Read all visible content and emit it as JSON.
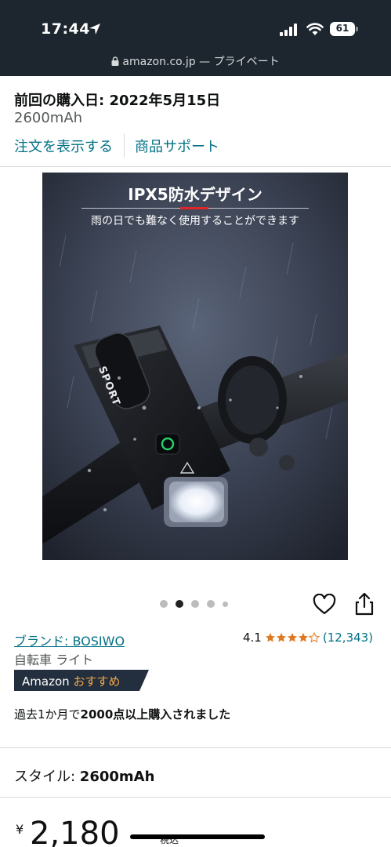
{
  "status_bar": {
    "time": "17:44",
    "battery": "61"
  },
  "url_bar": {
    "domain": "amazon.co.jp",
    "suffix": " — プライベート"
  },
  "order": {
    "last_purchase": "前回の購入日: 2022年5月15日",
    "variant": "2600mAh",
    "view_order": "注文を表示する",
    "product_support": "商品サポート"
  },
  "image": {
    "heading": "IPX5防水デザイン",
    "subheading": "雨の日でも難なく使用することができます",
    "device_label": "SPORT"
  },
  "carousel": {
    "count": 5,
    "active_index": 1
  },
  "brand": {
    "link": "ブランド: BOSIWO",
    "category": "自転車 ライト"
  },
  "rating": {
    "value": "4.1",
    "stars": 4.1,
    "count": "(12,343)"
  },
  "badge": {
    "prefix": "Amazon ",
    "highlight": "おすすめ"
  },
  "bought": {
    "pre": "過去1か月で",
    "bold": "2000点以上購入されました"
  },
  "style": {
    "label": "スタイル: ",
    "value": "2600mAh"
  },
  "price": {
    "currency": "¥",
    "amount": "2,180",
    "tax": "税込"
  },
  "colors": {
    "link": "#007185",
    "dark_bar": "#1d262e",
    "star": "#de7921",
    "badge_bg": "#232f3e",
    "badge_accent": "#f3a847"
  },
  "icons": [
    "location-arrow-icon",
    "signal-icon",
    "wifi-icon",
    "battery-icon",
    "lock-icon",
    "heart-icon",
    "share-icon",
    "star-icon"
  ]
}
